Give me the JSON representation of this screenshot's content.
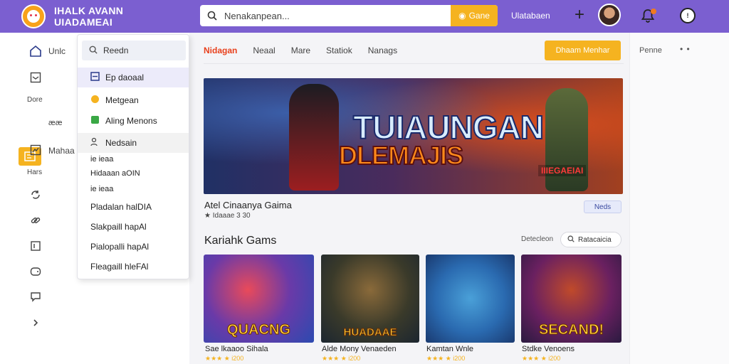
{
  "header": {
    "brand_line1": "IHALK AVANN",
    "brand_line2": "UIADAMEAI",
    "search_placeholder": "Nenakanpean...",
    "search_button": "Gane",
    "link": "Ulatabaen"
  },
  "rail": {
    "label_home": "Unlc",
    "section_a": "Dore",
    "active_label": "ææ",
    "label_media": "Mahaa",
    "section_b": "Hars"
  },
  "dropdown": {
    "search": "Reedn",
    "items": [
      "Ep daoaal",
      "Metgean",
      "Aling Menons",
      "Nedsain"
    ],
    "small": [
      "ie ieaa",
      "Hidaaan aOIN",
      "ie ieaa"
    ],
    "entries": [
      "Pladalan halDIA",
      "Slakpaill hapAl",
      "Pialopalli hapAl",
      "Fleagaill hleFAl"
    ]
  },
  "tabs": [
    "Nidagan",
    "Neaal",
    "Mare",
    "Statiok",
    "Nanags"
  ],
  "cta": "Dhaam Menhar",
  "more": "Penne",
  "more_dots": "• •",
  "featured": {
    "banner_line1": "TUIAUNGAN",
    "banner_line2": "DLEMAJIS",
    "banner_tag": "IIIEGAEIAI",
    "title": "Atel Cinaanya Gaima",
    "meta": "★ Idaaae 3 30",
    "pill": "Neds"
  },
  "section": {
    "title": "Kariahk Gams",
    "label": "Detecleon",
    "search": "Ratacaicia"
  },
  "cards": [
    {
      "art": "QUACNG",
      "title": "Sae lkaaoo Sihala",
      "meta": "★★★ ★ i200"
    },
    {
      "art": "HUADAAE",
      "title": "Alde Mony Venaeden",
      "meta": "★★★ ★ i200"
    },
    {
      "art": "",
      "title": "Kamtan Wnle",
      "meta": "★★★ ★ i200"
    },
    {
      "art": "SECAND!",
      "title": "Stdke Venoens",
      "meta": "★★★ ★ i200"
    }
  ],
  "colors": {
    "purple": "#7b5fd0",
    "accent": "#f5b320",
    "active_tab": "#e8401c"
  },
  "icons": [
    "search-icon",
    "plus-icon",
    "bell-icon",
    "clock-icon",
    "chevron-right-icon"
  ]
}
